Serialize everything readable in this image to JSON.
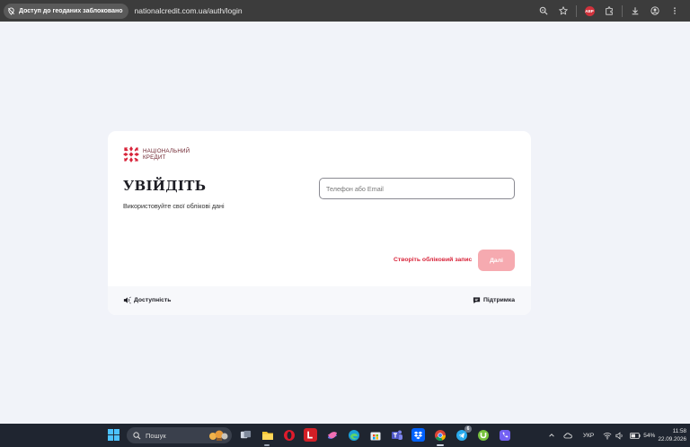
{
  "browser": {
    "geo_blocked_label": "Доступ до геоданих заблоковано",
    "url": "nationalcredit.com.ua/auth/login",
    "adblock_label": "ABP"
  },
  "logo": {
    "line1": "НАЦІОНАЛЬНИЙ",
    "line2": "КРЕДИТ",
    "color": "#6b1f2a",
    "accent": "#d8243a"
  },
  "login": {
    "title": "УВІЙДІТЬ",
    "subtitle": "Використовуйте свої облікові дані",
    "input_placeholder": "Телефон або Email",
    "input_value": "",
    "create_account": "Створіть обліковий запис",
    "next_button": "Далі",
    "button_color": "#f6aab0"
  },
  "footer": {
    "accessibility": "Доступність",
    "support": "Підтримка"
  },
  "taskbar": {
    "search_placeholder": "Пошук",
    "language": "УКР",
    "battery": "54%",
    "time": "11:58",
    "date": "22.09.2026",
    "telegram_badge": "6"
  }
}
